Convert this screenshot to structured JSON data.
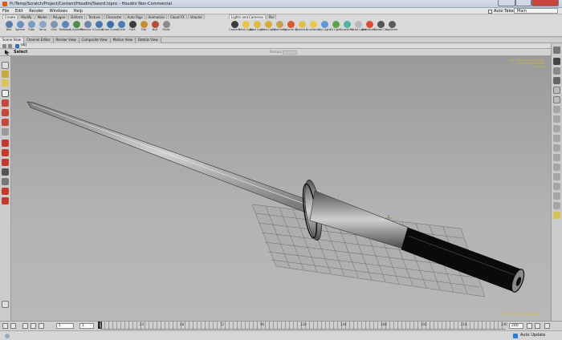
{
  "window": {
    "title": "H:/Temp/Scratch/Project/Content/Houdini/Sword.hipnc - Houdini Non-Commercial"
  },
  "menu": [
    "File",
    "Edit",
    "Render",
    "Windows",
    "Help"
  ],
  "topright": {
    "auto_takes": "Auto Takes",
    "desktop": "Main"
  },
  "shelf": {
    "tabs_left": [
      "Create",
      "Modify",
      "Model",
      "Polygon",
      "Deform",
      "Texture",
      "Character",
      "Auto Rigs",
      "Animation",
      "Cloud FX",
      "Volume"
    ],
    "tabs_right": [
      "Lights and Cameras",
      "Par"
    ],
    "tools_left": [
      {
        "label": "Box",
        "color": "#5a7aa8"
      },
      {
        "label": "Sphere",
        "color": "#6b8fbf"
      },
      {
        "label": "Tube",
        "color": "#7a9bc4"
      },
      {
        "label": "Torus",
        "color": "#8aa6c8"
      },
      {
        "label": "Grid",
        "color": "#7d95b0"
      },
      {
        "label": "Metaball",
        "color": "#5d86b9"
      },
      {
        "label": "L-System",
        "color": "#4f8c4f"
      },
      {
        "label": "Platonic S.",
        "color": "#6d86a6"
      },
      {
        "label": "Curve",
        "color": "#4a78b0"
      },
      {
        "label": "Draw Curve",
        "color": "#3f6fa8"
      },
      {
        "label": "Circle",
        "color": "#4d7db6"
      },
      {
        "label": "Font",
        "color": "#3a3a3a"
      },
      {
        "label": "File",
        "color": "#c98f2e"
      },
      {
        "label": "Null",
        "color": "#b5503a"
      },
      {
        "label": "Rivet",
        "color": "#8c8c8c"
      }
    ],
    "tools_right": [
      {
        "label": "Camera",
        "color": "#3b3b3b"
      },
      {
        "label": "Point Light",
        "color": "#e8c547"
      },
      {
        "label": "Spot Light",
        "color": "#e2b83e"
      },
      {
        "label": "Area Light",
        "color": "#d9ab3a"
      },
      {
        "label": "Geometry",
        "color": "#c6a04b"
      },
      {
        "label": "Volume Li.",
        "color": "#d65a2a"
      },
      {
        "label": "Distant L.",
        "color": "#e0c04a"
      },
      {
        "label": "Environm.",
        "color": "#e9c84f"
      },
      {
        "label": "Sky Light",
        "color": "#5b9bd5"
      },
      {
        "label": "GI Light",
        "color": "#5da34f"
      },
      {
        "label": "Caustic Li.",
        "color": "#4fb3a0"
      },
      {
        "label": "Portal Light",
        "color": "#b9b9b9"
      },
      {
        "label": "Ambient L.",
        "color": "#d94c3a"
      },
      {
        "label": "Stereo Ca.",
        "color": "#555555"
      },
      {
        "label": "Switcher",
        "color": "#5a5a5a"
      }
    ]
  },
  "pane_tabs": [
    "Scene View",
    "Channel Editor",
    "Render View",
    "Composite View",
    "Motion View",
    "Details View"
  ],
  "path": "obj",
  "viewport": {
    "tool": "Select",
    "radius_label": "Radius",
    "watermark": "Non-Commercial Edition",
    "hud_lines": [
      "Non-Commercial Edition",
      "Use of this software limited"
    ]
  },
  "timeline": {
    "start_frame": "1",
    "end_frame": "1",
    "current_frame": "1",
    "range_end": "240",
    "ticks": [
      "1",
      "24",
      "48",
      "72",
      "96",
      "120",
      "144",
      "168",
      "192",
      "216",
      "240"
    ]
  },
  "status": {
    "auto_update": "Auto Update"
  }
}
